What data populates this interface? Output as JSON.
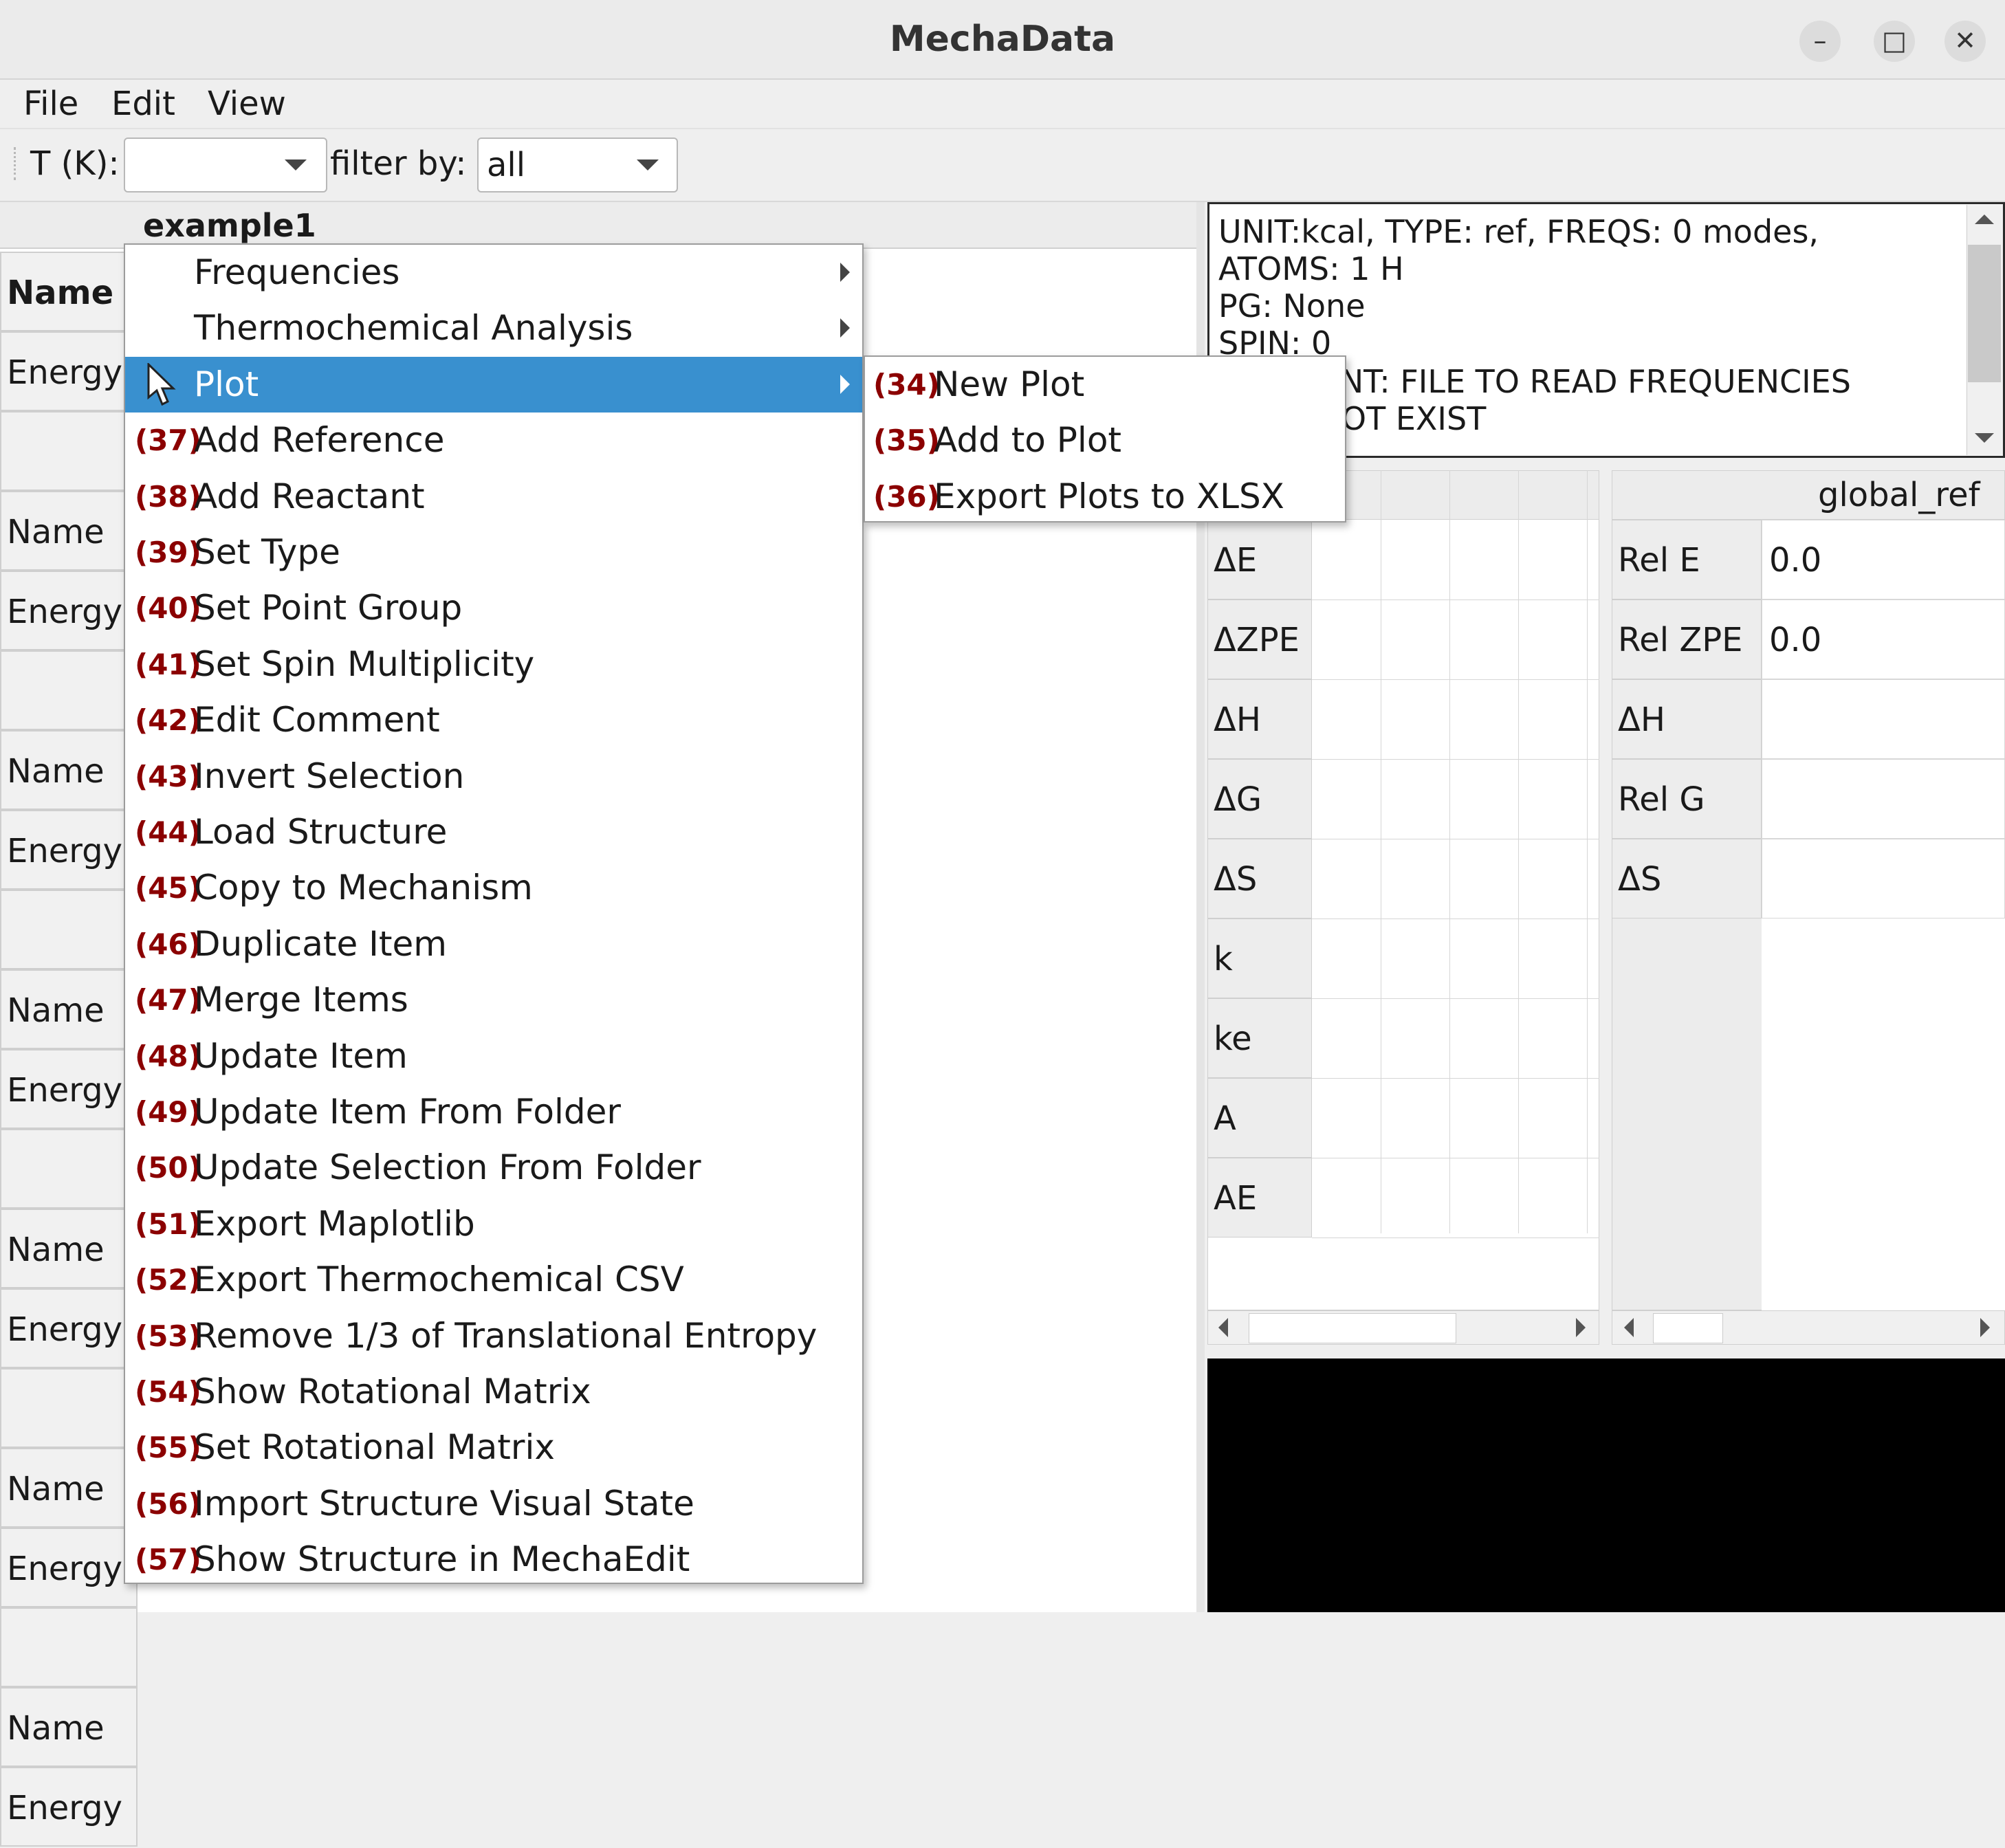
{
  "window": {
    "title": "MechaData",
    "minimize": "–",
    "maximize": "□",
    "close": "✕"
  },
  "menubar": [
    "File",
    "Edit",
    "View"
  ],
  "toolbar": {
    "t_label": "T (K):",
    "t_value": "",
    "filter_label": "filter by:",
    "filter_value": "all"
  },
  "left_panel": {
    "tab_title": "example1",
    "rows": [
      "Name",
      "Energy",
      "",
      "Name",
      "Energy",
      "",
      "Name",
      "Energy",
      "",
      "Name",
      "Energy",
      "",
      "Name",
      "Energy",
      "",
      "Name",
      "Energy",
      "",
      "Name",
      "Energy"
    ]
  },
  "info_box": {
    "lines": [
      "UNIT:kcal,  TYPE: ref,  FREQS: 0 modes,",
      "ATOMS: 1 H",
      "PG: None",
      "SPIN: 0",
      "COMMENT: FILE  TO READ FREQUENCIES",
      "DOES NOT EXIST"
    ]
  },
  "delta_table": {
    "rows": [
      "ΔE",
      "ΔZPE",
      "ΔH",
      "ΔG",
      "ΔS",
      "k",
      "ke",
      "A",
      "AE"
    ]
  },
  "ref_table": {
    "column": "global_ref",
    "rows": [
      {
        "label": "Rel E",
        "value": "0.0"
      },
      {
        "label": "Rel ZPE",
        "value": "0.0"
      },
      {
        "label": "ΔH",
        "value": ""
      },
      {
        "label": "Rel G",
        "value": ""
      },
      {
        "label": "ΔS",
        "value": ""
      }
    ]
  },
  "context_menu": {
    "items": [
      {
        "num": "",
        "label": "Frequencies",
        "submenu": true
      },
      {
        "num": "",
        "label": "Thermochemical Analysis",
        "submenu": true
      },
      {
        "num": "",
        "label": "Plot",
        "submenu": true,
        "highlighted": true
      },
      {
        "num": "(37)",
        "label": "Add Reference"
      },
      {
        "num": "(38)",
        "label": "Add Reactant"
      },
      {
        "num": "(39)",
        "label": "Set Type"
      },
      {
        "num": "(40)",
        "label": "Set Point Group"
      },
      {
        "num": "(41)",
        "label": "Set Spin Multiplicity"
      },
      {
        "num": "(42)",
        "label": "Edit Comment"
      },
      {
        "num": "(43)",
        "label": "Invert Selection"
      },
      {
        "num": "(44)",
        "label": "Load Structure"
      },
      {
        "num": "(45)",
        "label": "Copy to Mechanism"
      },
      {
        "num": "(46)",
        "label": "Duplicate Item"
      },
      {
        "num": "(47)",
        "label": "Merge Items"
      },
      {
        "num": "(48)",
        "label": "Update Item"
      },
      {
        "num": "(49)",
        "label": "Update Item From Folder"
      },
      {
        "num": "(50)",
        "label": "Update Selection From Folder"
      },
      {
        "num": "(51)",
        "label": "Export Maplotlib"
      },
      {
        "num": "(52)",
        "label": "Export Thermochemical CSV"
      },
      {
        "num": "(53)",
        "label": "Remove 1/3 of Translational Entropy"
      },
      {
        "num": "(54)",
        "label": "Show Rotational Matrix"
      },
      {
        "num": "(55)",
        "label": "Set Rotational Matrix"
      },
      {
        "num": "(56)",
        "label": "Import Structure Visual State"
      },
      {
        "num": "(57)",
        "label": "Show Structure in MechaEdit"
      }
    ]
  },
  "plot_submenu": {
    "items": [
      {
        "num": "(34)",
        "label": "New Plot"
      },
      {
        "num": "(35)",
        "label": "Add to Plot"
      },
      {
        "num": "(36)",
        "label": "Export Plots to XLSX"
      }
    ]
  },
  "colors": {
    "highlight": "#3990cf",
    "number": "#8b0000"
  }
}
